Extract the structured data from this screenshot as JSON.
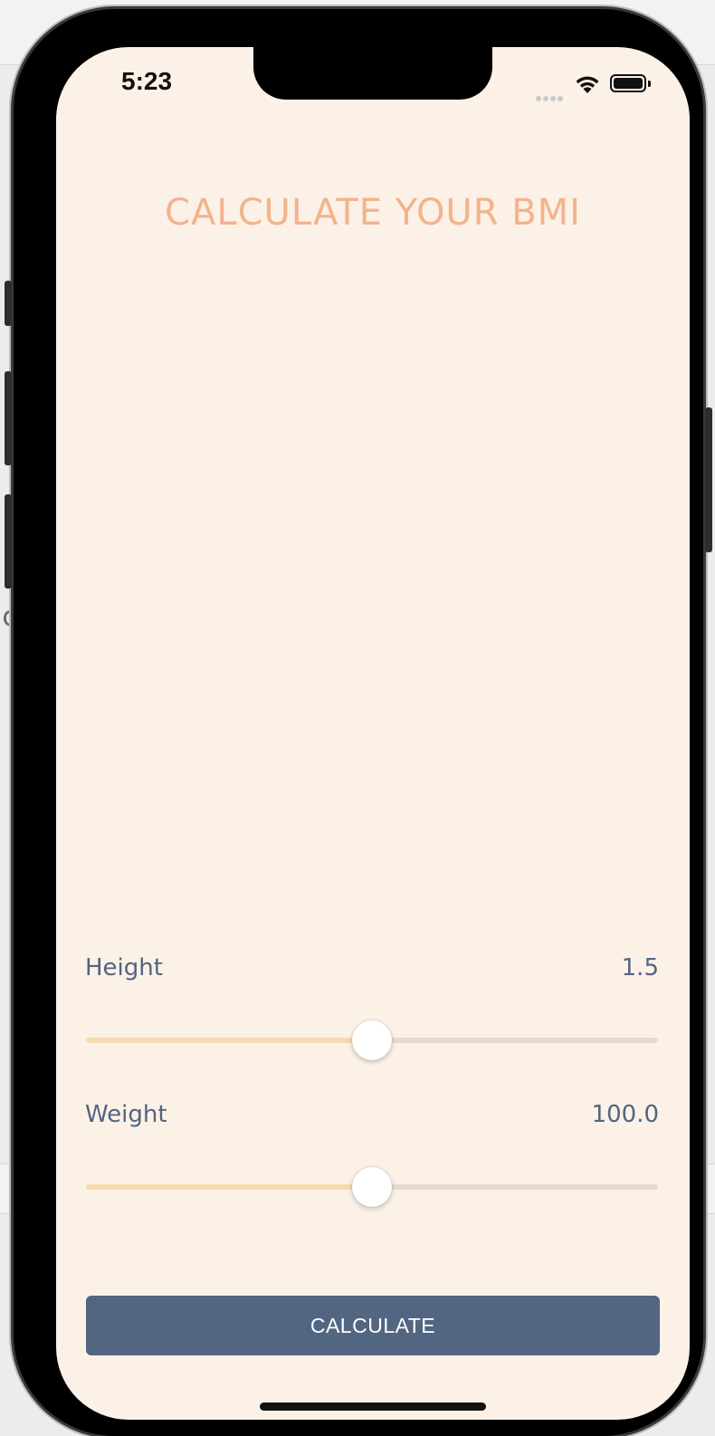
{
  "desktop": {
    "side_fragment": "ic"
  },
  "status_bar": {
    "time": "5:23"
  },
  "app": {
    "title": "CALCULATE YOUR BMI",
    "height": {
      "label": "Height",
      "value": "1.5",
      "fill_fraction": 0.5
    },
    "weight": {
      "label": "Weight",
      "value": "100.0",
      "fill_fraction": 0.5
    },
    "calculate_label": "CALCULATE"
  },
  "colors": {
    "background": "#fcf1e6",
    "title": "#f3b38d",
    "label": "#526581",
    "button": "#526581",
    "track_active": "#f6dbb0",
    "track_inactive": "#e6dbd1"
  },
  "icons": [
    "wifi-icon",
    "battery-icon",
    "cellular-signal-icon"
  ]
}
